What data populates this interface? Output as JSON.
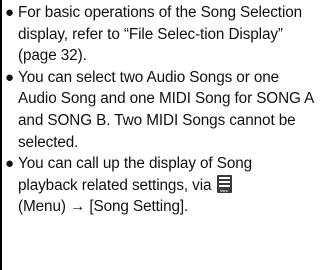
{
  "notes": [
    {
      "text": "For basic operations of the Song Selection display, refer to “File Selec-tion Display” (page 32)."
    },
    {
      "text": "You can select two Audio Songs or one Audio Song and one MIDI Song for SONG A and SONG B. Two MIDI Songs cannot be selected."
    },
    {
      "text_before_icon": "You can call up the display of Song playback related settings, via ",
      "icon": "menu-icon",
      "icon_caption": "Menu",
      "text_after_icon": "(Menu) → [Song Setting]."
    }
  ]
}
